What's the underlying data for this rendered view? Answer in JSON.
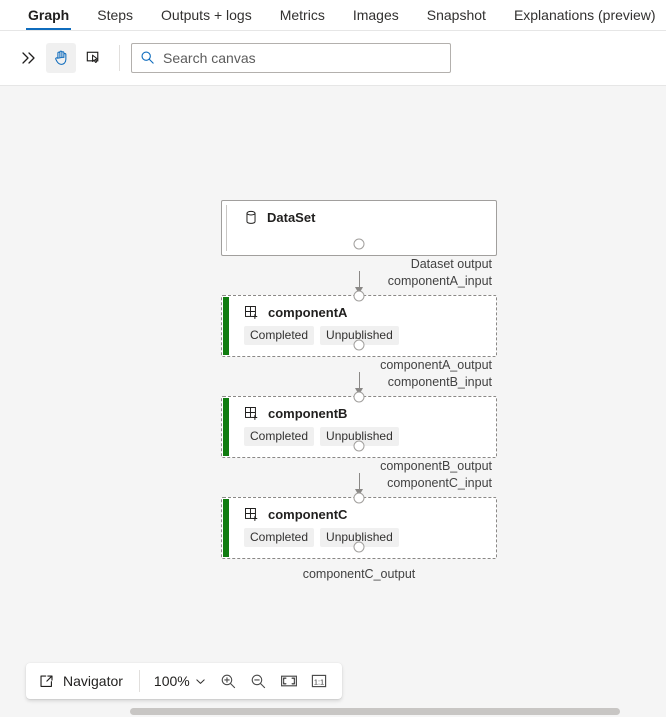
{
  "tabs": [
    {
      "label": "Graph",
      "active": true
    },
    {
      "label": "Steps",
      "active": false
    },
    {
      "label": "Outputs + logs",
      "active": false
    },
    {
      "label": "Metrics",
      "active": false
    },
    {
      "label": "Images",
      "active": false
    },
    {
      "label": "Snapshot",
      "active": false
    },
    {
      "label": "Explanations (preview)",
      "active": false
    }
  ],
  "toolbar": {
    "expand_icon": "chevron-double-right-icon",
    "pan_icon": "hand-pan-icon",
    "select_icon": "cursor-select-icon",
    "search": {
      "icon": "search-icon",
      "placeholder": "Search canvas",
      "value": ""
    }
  },
  "graph": {
    "nodes": [
      {
        "id": "dataset",
        "title": "DataSet",
        "icon": "database-icon",
        "type": "dataset",
        "badges": []
      },
      {
        "id": "componentA",
        "title": "componentA",
        "icon": "component-add-icon",
        "type": "component",
        "status_color": "#107c10",
        "badges": [
          "Completed",
          "Unpublished"
        ]
      },
      {
        "id": "componentB",
        "title": "componentB",
        "icon": "component-add-icon",
        "type": "component",
        "status_color": "#107c10",
        "badges": [
          "Completed",
          "Unpublished"
        ]
      },
      {
        "id": "componentC",
        "title": "componentC",
        "icon": "component-add-icon",
        "type": "component",
        "status_color": "#107c10",
        "badges": [
          "Completed",
          "Unpublished"
        ]
      }
    ],
    "edges": [
      {
        "source_label": "Dataset output",
        "target_label": "componentA_input"
      },
      {
        "source_label": "componentA_output",
        "target_label": "componentB_input"
      },
      {
        "source_label": "componentB_output",
        "target_label": "componentC_input"
      }
    ],
    "tail_label": "componentC_output"
  },
  "navigator": {
    "icon": "navigator-expand-icon",
    "label": "Navigator",
    "zoom_level": "100%",
    "zoom_chevron": "chevron-down-icon",
    "zoom_in_icon": "zoom-in-icon",
    "zoom_out_icon": "zoom-out-icon",
    "fit_icon": "fit-to-screen-icon",
    "actual_size_icon": "one-to-one-icon"
  },
  "colors": {
    "accent": "#0f6cbd",
    "status_green": "#107c10",
    "canvas_bg": "#f5f5f5"
  }
}
